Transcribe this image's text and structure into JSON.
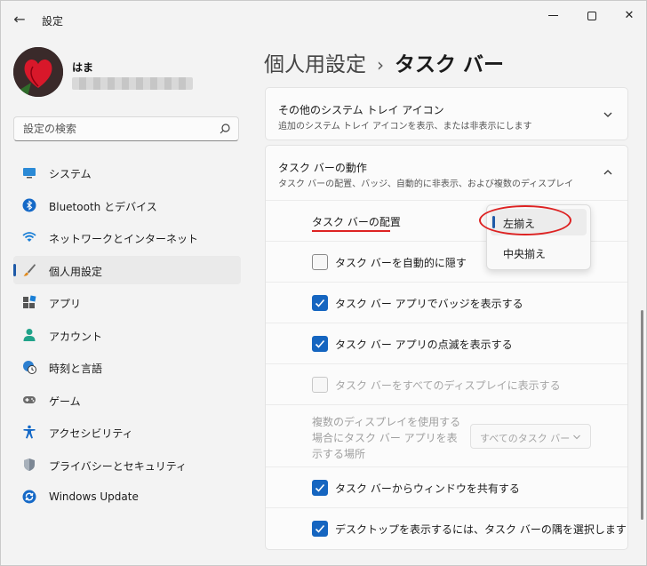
{
  "app": {
    "title": "設定",
    "back_icon": "arrow-left-icon"
  },
  "window_controls": [
    "minimize-icon",
    "maximize-icon",
    "close-icon"
  ],
  "user": {
    "name": "はま"
  },
  "search": {
    "placeholder": "設定の検索"
  },
  "sidebar": {
    "items": [
      {
        "label": "システム",
        "icon": "monitor-icon"
      },
      {
        "label": "Bluetooth とデバイス",
        "icon": "bluetooth-icon"
      },
      {
        "label": "ネットワークとインターネット",
        "icon": "wifi-icon"
      },
      {
        "label": "個人用設定",
        "icon": "brush-icon",
        "selected": true
      },
      {
        "label": "アプリ",
        "icon": "apps-icon"
      },
      {
        "label": "アカウント",
        "icon": "person-icon"
      },
      {
        "label": "時刻と言語",
        "icon": "globe-clock-icon"
      },
      {
        "label": "ゲーム",
        "icon": "gamepad-icon"
      },
      {
        "label": "アクセシビリティ",
        "icon": "accessibility-icon"
      },
      {
        "label": "プライバシーとセキュリティ",
        "icon": "shield-icon"
      },
      {
        "label": "Windows Update",
        "icon": "update-icon"
      }
    ]
  },
  "header": {
    "breadcrumb_parent": "個人用設定",
    "separator": "›",
    "current": "タスク バー"
  },
  "tray_card": {
    "title": "その他のシステム トレイ アイコン",
    "description": "追加のシステム トレイ アイコンを表示、または非表示にします"
  },
  "behavior_card": {
    "title": "タスク バーの動作",
    "description": "タスク バーの配置、バッジ、自動的に非表示、および複数のディスプレイ",
    "alignment_label": "タスク バーの配置",
    "alignment_options": [
      {
        "label": "左揃え",
        "selected": true
      },
      {
        "label": "中央揃え",
        "selected": false
      }
    ],
    "checkboxes": [
      {
        "label": "タスク バーを自動的に隠す",
        "checked": false,
        "disabled": false
      },
      {
        "label": "タスク バー アプリでバッジを表示する",
        "checked": true,
        "disabled": false
      },
      {
        "label": "タスク バー アプリの点滅を表示する",
        "checked": true,
        "disabled": false
      },
      {
        "label": "タスク バーをすべてのディスプレイに表示する",
        "checked": false,
        "disabled": true
      }
    ],
    "multi_display_label": "複数のディスプレイを使用する場合にタスク バー アプリを表示する場所",
    "multi_display_value": "すべてのタスク バー",
    "bottom_checkboxes": [
      {
        "label": "タスク バーからウィンドウを共有する",
        "checked": true
      },
      {
        "label": "デスクトップを表示するには、タスク バーの隅を選択します",
        "checked": true
      }
    ]
  },
  "colors": {
    "accent": "#1565c0",
    "annotation": "#dd2222"
  }
}
